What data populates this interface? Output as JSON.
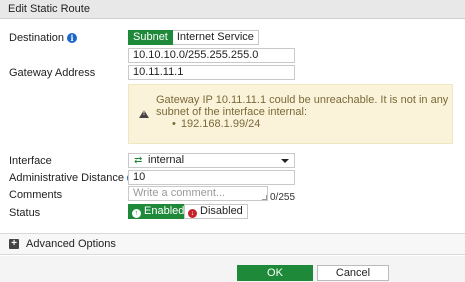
{
  "dialog": {
    "title": "Edit Static Route"
  },
  "destination": {
    "label": "Destination",
    "segments": {
      "subnet": "Subnet",
      "internet_service": "Internet Service"
    },
    "value": "10.10.10.0/255.255.255.0"
  },
  "gateway": {
    "label": "Gateway Address",
    "value": "10.11.11.1"
  },
  "warning": {
    "message": "Gateway IP 10.11.11.1 could be unreachable. It is not in any subnet of the interface internal:",
    "subnet": "192.168.1.99/24"
  },
  "interface": {
    "label": "Interface",
    "value": "internal"
  },
  "admin_distance": {
    "label": "Administrative Distance",
    "value": "10"
  },
  "comments": {
    "label": "Comments",
    "placeholder": "Write a comment...",
    "counter": "0/255"
  },
  "status": {
    "label": "Status",
    "enabled": "Enabled",
    "disabled": "Disabled"
  },
  "advanced": {
    "label": "Advanced Options"
  },
  "footer": {
    "ok": "OK",
    "cancel": "Cancel"
  },
  "colors": {
    "accent_green": "#1e8a39",
    "info_blue": "#1d66c9",
    "warn_bg": "#fbf3d9",
    "disabled_red": "#c8232c"
  }
}
